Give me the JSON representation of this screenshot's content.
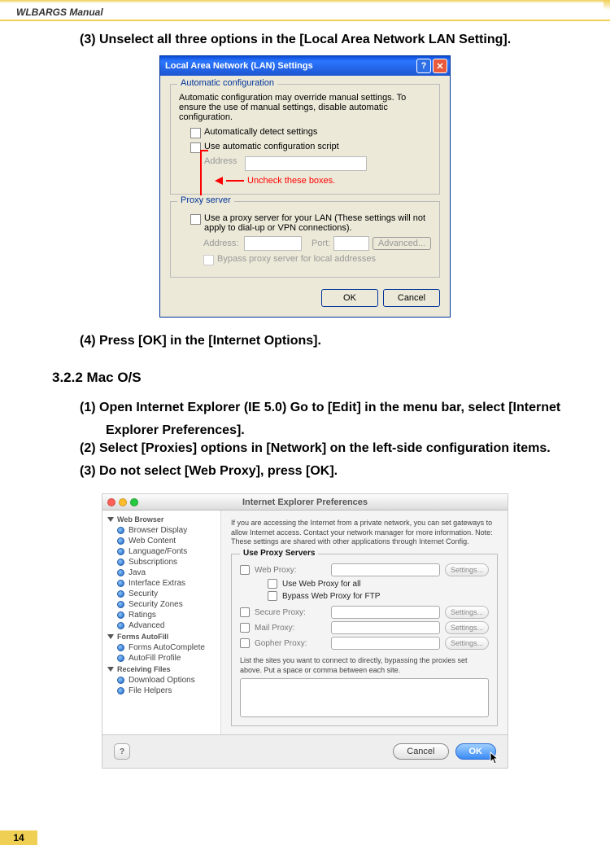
{
  "header": {
    "title": "WLBARGS Manual"
  },
  "page_number": "14",
  "steps": {
    "s3": "(3) Unselect all three options in the  [Local Area Network LAN Setting].",
    "s4": "(4) Press [OK] in the [Internet Options].",
    "section": "3.2.2 Mac O/S",
    "m1a": "(1) Open Internet Explorer (IE 5.0) Go to [Edit] in the menu bar, select [Internet",
    "m1b": "Explorer Preferences].",
    "m2": "(2) Select [Proxies] options in [Network] on the left-side configuration items.",
    "m3": "(3) Do not select [Web Proxy], press [OK]."
  },
  "win": {
    "title": "Local Area Network (LAN) Settings",
    "group1": "Automatic configuration",
    "desc": "Automatic configuration may override manual settings.  To ensure the use of manual settings, disable automatic configuration.",
    "cb1": "Automatically detect settings",
    "cb2": "Use automatic configuration script",
    "addr_label": "Address",
    "uncheck_note": "Uncheck these boxes.",
    "group2": "Proxy server",
    "cb3": "Use a proxy server for your LAN (These settings will not apply to dial-up or VPN connections).",
    "addr2": "Address:",
    "port": "Port:",
    "adv": "Advanced...",
    "bypass": "Bypass proxy server for local addresses",
    "ok": "OK",
    "cancel": "Cancel"
  },
  "mac": {
    "title": "Internet Explorer Preferences",
    "groups": {
      "g1": "Web Browser",
      "g2": "Forms AutoFill",
      "g3": "Receiving Files"
    },
    "items": {
      "i1": "Browser Display",
      "i2": "Web Content",
      "i3": "Language/Fonts",
      "i4": "Subscriptions",
      "i5": "Java",
      "i6": "Interface Extras",
      "i7": "Security",
      "i8": "Security Zones",
      "i9": "Ratings",
      "i10": "Advanced",
      "i11": "Forms AutoComplete",
      "i12": "AutoFill Profile",
      "i13": "Download Options",
      "i14": "File Helpers"
    },
    "desc": "If you are accessing the Internet from a private network, you can set gateways to allow Internet access.  Contact your network manager for more information.  Note: These settings are shared with other applications through Internet Config.",
    "fieldset_title": "Use Proxy Servers",
    "rows": {
      "web": "Web Proxy:",
      "use_all": "Use Web Proxy for all",
      "bypass_ftp": "Bypass Web Proxy for FTP",
      "secure": "Secure Proxy:",
      "mail": "Mail Proxy:",
      "gopher": "Gopher Proxy:"
    },
    "settings_btn": "Settings...",
    "list_desc": "List the sites you want to connect to directly,  bypassing the proxies set above.  Put a space or comma between each site.",
    "help": "?",
    "cancel": "Cancel",
    "ok": "OK"
  }
}
